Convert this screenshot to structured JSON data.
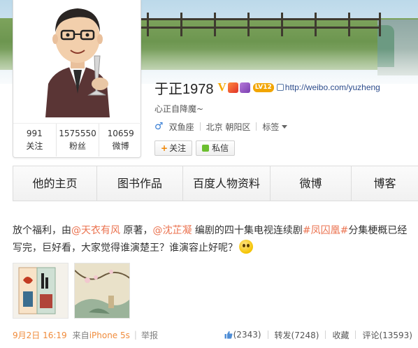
{
  "profile": {
    "name": "于正1978",
    "verified_icon": "V",
    "level_badge": "LV12",
    "homepage": "http://weibo.com/yuzheng",
    "bio": "心正自降魔~",
    "gender_icon": "♂",
    "constellation": "双鱼座",
    "location": "北京 朝阳区",
    "tags_label": "标签"
  },
  "stats": [
    {
      "count": "991",
      "label": "关注"
    },
    {
      "count": "1575550",
      "label": "粉丝"
    },
    {
      "count": "10659",
      "label": "微博"
    }
  ],
  "buttons": {
    "follow_plus": "+",
    "follow": "关注",
    "message": "私信"
  },
  "tabs": [
    {
      "label": "他的主页"
    },
    {
      "label": "图书作品"
    },
    {
      "label": "百度人物资料"
    },
    {
      "label": "微博"
    },
    {
      "label": "博客"
    }
  ],
  "post": {
    "text_1": "放个福利，由",
    "mention_1": "@天衣有风",
    "text_2": " 原著，",
    "mention_2": "@沈芷凝",
    "text_3": " 编剧的四十集电视连续剧",
    "topic": "#凤囚凰#",
    "text_4": "分集梗概已经写完，巨好看，大家觉得谁演楚王？谁演容止好呢？",
    "date": "9月2日 16:19",
    "source_prefix": "来自",
    "source": "iPhone 5s",
    "report": "举报",
    "likes": "(2343)",
    "repost": "转发(7248)",
    "favorite": "收藏",
    "comment": "评论(13593)"
  },
  "colors": {
    "link": "#eb7350",
    "meta_orange": "#f08c3c",
    "verified_gold": "#f5a800",
    "level_badge": "#f2a500"
  },
  "icons": {
    "verified": "verified-v-icon",
    "emoji": "smile-emoji-icon",
    "like": "thumbs-up-icon"
  }
}
